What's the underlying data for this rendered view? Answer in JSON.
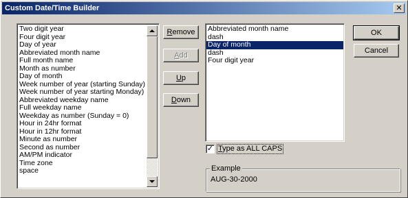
{
  "window": {
    "title": "Custom Date/Time Builder",
    "close_glyph": "✕"
  },
  "available_list": {
    "items": [
      "Two digit year",
      "Four digit year",
      "Day of year",
      "Abbreviated month name",
      "Full month name",
      "Month as number",
      "Day of month",
      "Week number of year (starting Sunday)",
      "Week number of year starting Monday)",
      "Abbreviated weekday name",
      "Full weekday name",
      "Weekday as number (Sunday = 0)",
      "Hour in 24hr format",
      "Hour in 12hr format",
      "Minute as number",
      "Second as number",
      "AM/PM indicator",
      "Time zone",
      "space"
    ]
  },
  "buttons": {
    "remove": {
      "mnemonic": "R",
      "rest": "emove"
    },
    "add": {
      "mnemonic": "A",
      "rest": "dd"
    },
    "up": {
      "mnemonic": "U",
      "rest": "p"
    },
    "down": {
      "mnemonic": "D",
      "rest": "own"
    },
    "ok": "OK",
    "cancel": "Cancel"
  },
  "selected_list": {
    "items": [
      "Abbreviated month name",
      "dash",
      "Day of month",
      "dash",
      "Four digit year"
    ],
    "selected_index": 2
  },
  "caps_checkbox": {
    "checked": true,
    "check_glyph": "✓",
    "label_mnemonic": "T",
    "label_rest": "ype as ALL CAPS"
  },
  "example": {
    "title": "Example",
    "value": "AUG-30-2000"
  }
}
